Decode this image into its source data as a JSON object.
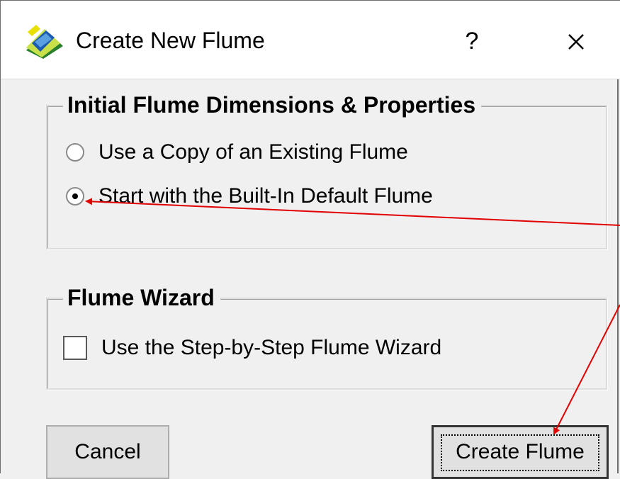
{
  "window": {
    "title": "Create New Flume",
    "help_label": "?",
    "app_icon": "flume-app-icon",
    "close_icon": "close-icon"
  },
  "group_initial": {
    "title": "Initial Flume Dimensions & Properties",
    "options": [
      {
        "label": "Use a Copy of an Existing Flume",
        "selected": false
      },
      {
        "label": "Start with the Built-In Default Flume",
        "selected": true
      }
    ]
  },
  "group_wizard": {
    "title": "Flume Wizard",
    "checkbox_label": "Use the Step-by-Step Flume Wizard",
    "checked": false
  },
  "buttons": {
    "cancel_label": "Cancel",
    "create_label": "Create Flume"
  },
  "colors": {
    "annotation_arrow": "#e00000",
    "dialog_bg": "#f0f0f0",
    "titlebar_bg": "#ffffff"
  }
}
